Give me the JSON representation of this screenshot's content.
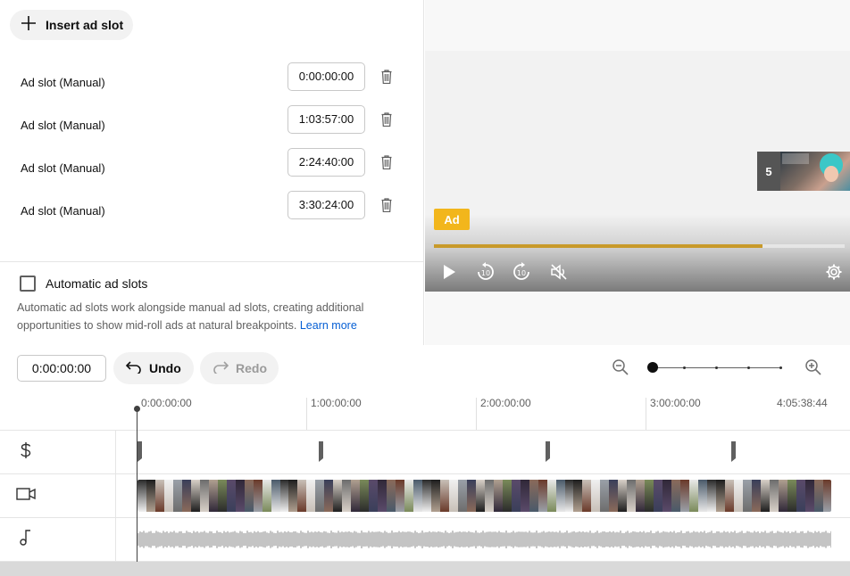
{
  "editor": {
    "insert_label": "Insert ad slot",
    "slots": [
      {
        "label": "Ad slot (Manual)",
        "time": "0:00:00:00"
      },
      {
        "label": "Ad slot (Manual)",
        "time": "1:03:57:00"
      },
      {
        "label": "Ad slot (Manual)",
        "time": "2:24:40:00"
      },
      {
        "label": "Ad slot (Manual)",
        "time": "3:30:24:00"
      }
    ],
    "automatic": {
      "title": "Automatic ad slots",
      "description": "Automatic ad slots work alongside manual ad slots, creating additional opportunities to show mid-roll ads at natural breakpoints.",
      "learn_more": "Learn more",
      "checked": false
    }
  },
  "player": {
    "ad_badge": "Ad",
    "next_count": "5",
    "progress_fraction": 0.8,
    "icons": [
      "play-icon",
      "rewind-10-icon",
      "forward-10-icon",
      "mute-icon",
      "settings-icon"
    ]
  },
  "toolbar": {
    "current_time": "0:00:00:00",
    "undo_label": "Undo",
    "redo_label": "Redo",
    "zoom_level_index": 0,
    "zoom_steps": 5
  },
  "timeline": {
    "ruler_labels": [
      "0:00:00:00",
      "1:00:00:00",
      "2:00:00:00",
      "3:00:00:00",
      "4:05:38:44"
    ],
    "tracks": [
      "ad-track",
      "video-track",
      "audio-track"
    ],
    "ad_marker_times": [
      "0:00:00:00",
      "1:03:57:00",
      "2:24:40:00",
      "3:30:24:00"
    ]
  },
  "colors": {
    "ad_badge": "#f2b61c",
    "progress": "#c89a2a",
    "link": "#065fd4"
  }
}
